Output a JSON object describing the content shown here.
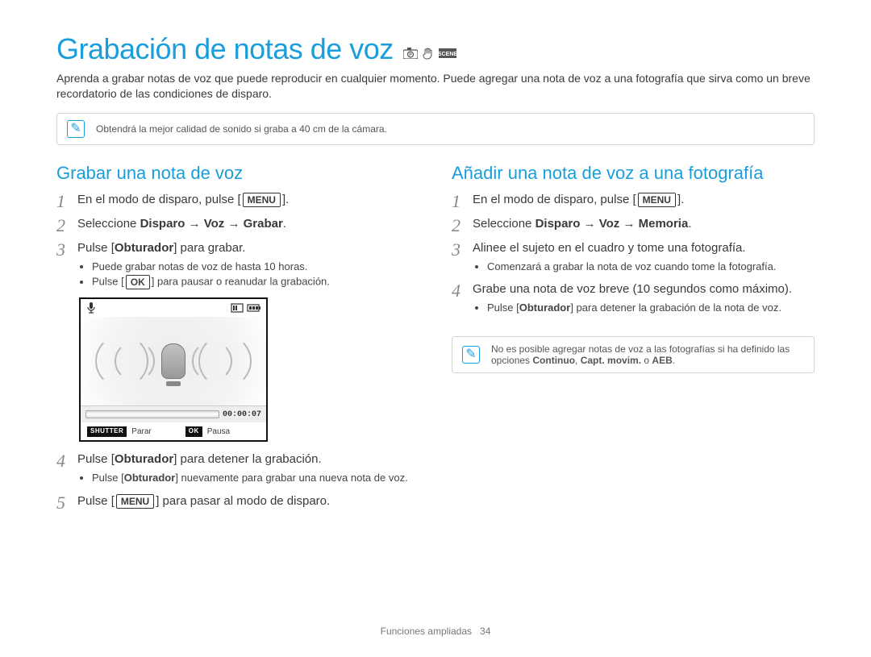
{
  "title": "Grabación de notas de voz",
  "intro": "Aprenda a grabar notas de voz que puede reproducir en cualquier momento. Puede agregar una nota de voz a una fotografía que sirva como un breve recordatorio de las condiciones de disparo.",
  "top_note": "Obtendrá la mejor calidad de sonido si graba a 40 cm de la cámara.",
  "mode_icons": [
    "camera-p",
    "hand",
    "scene"
  ],
  "left": {
    "section_title": "Grabar una nota de voz",
    "steps": {
      "s1_a": "En el modo de disparo, pulse [",
      "s1_btn": "MENU",
      "s1_b": "].",
      "s2_a": "Seleccione ",
      "s2_bold": "Disparo → Voz → Grabar",
      "s2_b": ".",
      "s3_a": "Pulse [",
      "s3_bold": "Obturador",
      "s3_b": "] para grabar.",
      "s3_sub1": "Puede grabar notas de voz de hasta 10 horas.",
      "s3_sub2a": "Pulse [",
      "s3_sub2_btn": "OK",
      "s3_sub2b": "] para pausar o reanudar la grabación.",
      "s4_a": "Pulse [",
      "s4_bold": "Obturador",
      "s4_b": "] para detener la grabación.",
      "s4_sub1a": "Pulse [",
      "s4_sub1_bold": "Obturador",
      "s4_sub1b": "] nuevamente para grabar una nueva nota de voz.",
      "s5_a": "Pulse [",
      "s5_btn": "MENU",
      "s5_b": "] para pasar al modo de disparo."
    },
    "screen": {
      "time": "00:00:07",
      "shutter_tag": "SHUTTER",
      "shutter_text": "Parar",
      "ok_tag": "OK",
      "ok_text": "Pausa"
    }
  },
  "right": {
    "section_title": "Añadir una nota de voz a una fotografía",
    "steps": {
      "s1_a": "En el modo de disparo, pulse [",
      "s1_btn": "MENU",
      "s1_b": "].",
      "s2_a": "Seleccione ",
      "s2_bold": "Disparo → Voz → Memoria",
      "s2_b": ".",
      "s3": "Alinee el sujeto en el cuadro y tome una fotografía.",
      "s3_sub1": "Comenzará a grabar la nota de voz cuando tome la fotografía.",
      "s4": "Grabe una nota de voz breve (10 segundos como máximo).",
      "s4_sub1a": "Pulse [",
      "s4_sub1_bold": "Obturador",
      "s4_sub1b": "] para detener la grabación de la nota de voz."
    },
    "note_a": "No es posible agregar notas de voz a las fotografías si ha definido las opciones ",
    "note_bold1": "Continuo",
    "note_sep1": ", ",
    "note_bold2": "Capt. movim.",
    "note_sep2": " o ",
    "note_bold3": "AEB",
    "note_b": "."
  },
  "footer": {
    "section": "Funciones ampliadas",
    "page": "34"
  }
}
